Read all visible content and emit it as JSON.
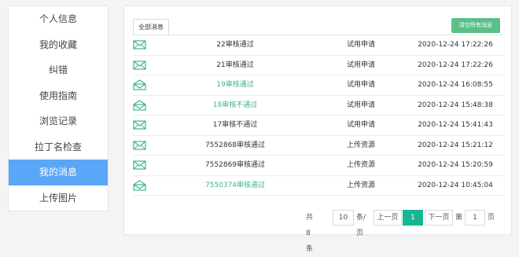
{
  "sidebar": {
    "items": [
      {
        "label": "个人信息"
      },
      {
        "label": "我的收藏"
      },
      {
        "label": "纠错"
      },
      {
        "label": "使用指南"
      },
      {
        "label": "浏览记录"
      },
      {
        "label": "拉丁名检查"
      },
      {
        "label": "我的消息",
        "active": true
      },
      {
        "label": "上传图片"
      }
    ]
  },
  "main": {
    "tab_label": "全部消息",
    "clear_button_label": "清空所有消息",
    "messages": [
      {
        "title": "22审核通过",
        "type": "试用申请",
        "time": "2020-12-24 17:22:26",
        "read": false
      },
      {
        "title": "21审核通过",
        "type": "试用申请",
        "time": "2020-12-24 17:22:26",
        "read": false
      },
      {
        "title": "19审核通过",
        "type": "试用申请",
        "time": "2020-12-24 16:08:55",
        "read": true
      },
      {
        "title": "18审核不通过",
        "type": "试用申请",
        "time": "2020-12-24 15:48:38",
        "read": true
      },
      {
        "title": "17审核不通过",
        "type": "试用申请",
        "time": "2020-12-24 15:41:43",
        "read": false
      },
      {
        "title": "7552868审核通过",
        "type": "上传资源",
        "time": "2020-12-24 15:21:12",
        "read": false
      },
      {
        "title": "7552869审核通过",
        "type": "上传资源",
        "time": "2020-12-24 15:20:59",
        "read": false
      },
      {
        "title": "7550374审核通过",
        "type": "上传资源",
        "time": "2020-12-24 10:45:04",
        "read": true
      }
    ]
  },
  "pagination": {
    "total": "共8条",
    "page_size": "10",
    "per_page_label": "条/页",
    "prev_label": "上一页",
    "current_page": "1",
    "next_label": "下一页",
    "goto_prefix": "第",
    "goto_value": "1",
    "goto_suffix": "页"
  },
  "colors": {
    "active_sidebar": "#5aa6f7",
    "accent_green": "#3fb38b",
    "clear_button": "#5cbf8a",
    "current_page": "#15b793"
  }
}
